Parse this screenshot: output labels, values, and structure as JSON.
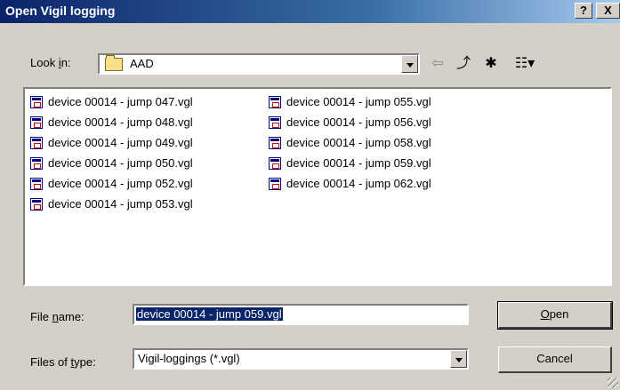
{
  "window": {
    "title": "Open Vigil logging",
    "help_label": "?",
    "close_label": "X"
  },
  "lookin": {
    "label_pre": "Look ",
    "label_accel": "i",
    "label_post": "n:",
    "value": "AAD"
  },
  "toolbar": {
    "back_glyph": "⇦",
    "up_glyph": "⤴",
    "newfolder_glyph": "✱",
    "view_glyph": "☷▾"
  },
  "files": {
    "column1": [
      "device 00014 - jump 047.vgl",
      "device 00014 - jump 048.vgl",
      "device 00014 - jump 049.vgl",
      "device 00014 - jump 050.vgl",
      "device 00014 - jump 052.vgl",
      "device 00014 - jump 053.vgl"
    ],
    "column2": [
      "device 00014 - jump 055.vgl",
      "device 00014 - jump 056.vgl",
      "device 00014 - jump 058.vgl",
      "device 00014 - jump 059.vgl",
      "device 00014 - jump 062.vgl"
    ]
  },
  "filename": {
    "label_pre": "File ",
    "label_accel": "n",
    "label_post": "ame:",
    "value": "device 00014 - jump 059.vgl"
  },
  "filetype": {
    "label_pre": "Files of ",
    "label_accel": "t",
    "label_post": "ype:",
    "value": "Vigil-loggings (*.vgl)"
  },
  "buttons": {
    "open_accel": "O",
    "open_rest": "pen",
    "cancel": "Cancel"
  }
}
